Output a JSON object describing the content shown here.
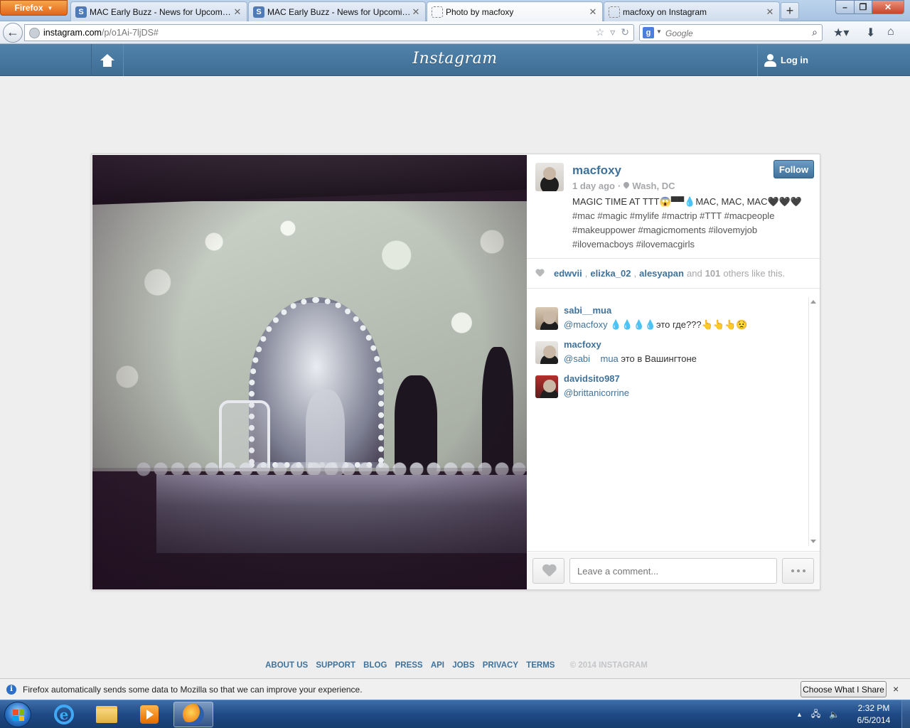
{
  "browser": {
    "menu_button": "Firefox",
    "tabs": [
      {
        "label": "MAC Early Buzz - News for Upcomin...",
        "favicon": "S",
        "active": false
      },
      {
        "label": "MAC Early Buzz - News for Upcomin...",
        "favicon": "S",
        "active": false
      },
      {
        "label": "Photo by macfoxy",
        "favicon": "",
        "active": true
      },
      {
        "label": "macfoxy on Instagram",
        "favicon": "",
        "active": false
      }
    ],
    "url_host": "instagram.com",
    "url_path": "/p/o1Ai-7ljDS#",
    "search_placeholder": "Google",
    "search_engine_icon": "google-icon"
  },
  "ig_header": {
    "logo": "Instagram",
    "login_label": "Log in"
  },
  "post": {
    "username": "macfoxy",
    "time_ago": "1 day ago",
    "separator": "·",
    "location": "Wash, DC",
    "follow_label": "Follow",
    "caption_text": "MAGIC TIME AT TTT😱▀▀💧MAC, MAC, MAC🖤🖤🖤",
    "caption_tags": "#mac #magic #mylife #mactrip #TTT #macpeople #makeuppower #magicmoments #ilovemyjob #ilovemacboys #ilovemacgirls",
    "likes": {
      "users": [
        "edwvii",
        "elizka_02",
        "alesyapan"
      ],
      "sep": ",",
      "and_text": "and",
      "count": "101",
      "tail_text": "others like this."
    },
    "comments": [
      {
        "user": "sabi__mua",
        "mention": "@macfoxy",
        "text": "💧💧💧💧это где???👆👆👆😟"
      },
      {
        "user": "macfoxy",
        "mention": "@sabi    mua",
        "text": "это в Вашингтоне"
      },
      {
        "user": "davidsito987",
        "mention": "@brittanicorrine",
        "text": ""
      }
    ],
    "comment_placeholder": "Leave a comment..."
  },
  "footer": {
    "links": [
      "ABOUT US",
      "SUPPORT",
      "BLOG",
      "PRESS",
      "API",
      "JOBS",
      "PRIVACY",
      "TERMS"
    ],
    "copyright": "© 2014 INSTAGRAM"
  },
  "notification": {
    "text": "Firefox automatically sends some data to Mozilla so that we can improve your experience.",
    "button": "Choose What I Share",
    "close": "×"
  },
  "taskbar": {
    "time": "2:32 PM",
    "date": "6/5/2014",
    "pinned": [
      "ie-icon",
      "folder-icon",
      "media-player-icon",
      "firefox-icon"
    ]
  },
  "colors": {
    "ig_blue": "#3f729b",
    "header_blue": "#4a7aa2",
    "firefox_orange": "#e2651c"
  }
}
